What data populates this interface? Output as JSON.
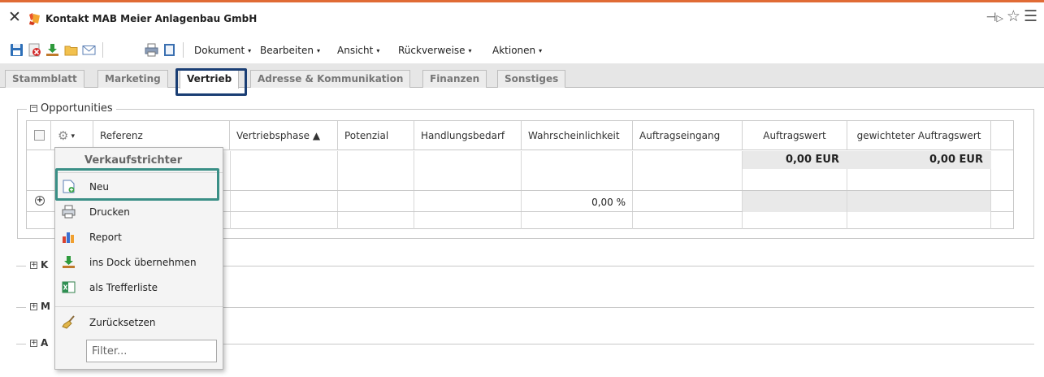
{
  "window": {
    "title": "Kontakt MAB Meier Anlagenbau GmbH",
    "close_glyph": "✕",
    "pin_glyph": "⊣⊳",
    "star_glyph": "☆",
    "menu_glyph": "☰"
  },
  "toolbar": {
    "icons": [
      "save-icon",
      "delete-icon",
      "dock-download-icon",
      "folder-icon",
      "email-icon",
      "print-icon",
      "notepad-icon"
    ],
    "menus": [
      {
        "label": "Dokument"
      },
      {
        "label": "Bearbeiten"
      },
      {
        "label": "Ansicht"
      },
      {
        "label": "Rückverweise"
      },
      {
        "label": "Aktionen"
      }
    ],
    "caret": "▾"
  },
  "tabs": [
    {
      "label": "Stammblatt",
      "active": false
    },
    {
      "label": "Marketing",
      "active": false
    },
    {
      "label": "Vertrieb",
      "active": true
    },
    {
      "label": "Adresse & Kommunikation",
      "active": false
    },
    {
      "label": "Finanzen",
      "active": false
    },
    {
      "label": "Sonstiges",
      "active": false
    }
  ],
  "opportunities": {
    "legend": "Opportunities",
    "collapse_glyph": "−",
    "columns": [
      {
        "label": "Referenz"
      },
      {
        "label": "Vertriebsphase ▲"
      },
      {
        "label": "Potenzial"
      },
      {
        "label": "Handlungsbedarf"
      },
      {
        "label": "Wahrscheinlichkeit"
      },
      {
        "label": "Auftragseingang"
      },
      {
        "label": "Auftragswert"
      },
      {
        "label": "gewichteter Auftragswert"
      }
    ],
    "totals": {
      "auftragswert": "0,00 EUR",
      "gewichteter_auftragswert": "0,00 EUR"
    },
    "row": {
      "expand_glyph": "+",
      "wahrscheinlichkeit": "0,00 %"
    }
  },
  "sections": [
    {
      "label": "K",
      "expand_glyph": "+"
    },
    {
      "label": "M",
      "expand_glyph": "+"
    },
    {
      "label": "A",
      "expand_glyph": "+"
    }
  ],
  "dropdown": {
    "header": "Verkaufstrichter",
    "items": [
      {
        "label": "Neu",
        "icon": "new-document-icon"
      },
      {
        "label": "Drucken",
        "icon": "printer-icon"
      },
      {
        "label": "Report",
        "icon": "bar-chart-icon"
      },
      {
        "label": "ins Dock übernehmen",
        "icon": "dock-download-icon"
      },
      {
        "label": "als Trefferliste",
        "icon": "excel-list-icon"
      },
      {
        "label": "Zurücksetzen",
        "icon": "broom-icon"
      }
    ],
    "filter_placeholder": "Filter..."
  },
  "colors": {
    "accent_orange": "#e06b35",
    "tab_highlight": "#1a3e74",
    "menu_highlight": "#3a8f86"
  }
}
